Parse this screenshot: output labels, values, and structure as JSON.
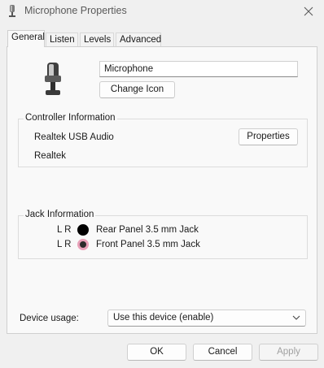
{
  "window": {
    "title": "Microphone Properties"
  },
  "tabs": [
    {
      "label": "General",
      "active": true
    },
    {
      "label": "Listen",
      "active": false
    },
    {
      "label": "Levels",
      "active": false
    },
    {
      "label": "Advanced",
      "active": false
    }
  ],
  "device": {
    "name": "Microphone",
    "change_icon_label": "Change Icon"
  },
  "controller": {
    "group_label": "Controller Information",
    "name": "Realtek USB Audio",
    "vendor": "Realtek",
    "properties_label": "Properties"
  },
  "jack": {
    "group_label": "Jack Information",
    "rows": [
      {
        "lr": "L R",
        "label": "Rear Panel 3.5 mm Jack",
        "color": "#000000"
      },
      {
        "lr": "L R",
        "label": "Front Panel 3.5 mm Jack",
        "color": "#e8a0b8"
      }
    ]
  },
  "usage": {
    "label": "Device usage:",
    "value": "Use this device (enable)"
  },
  "footer": {
    "ok": "OK",
    "cancel": "Cancel",
    "apply": "Apply"
  },
  "colors": {
    "accent": "#0067c0",
    "window_bg": "#f0f0f0"
  }
}
